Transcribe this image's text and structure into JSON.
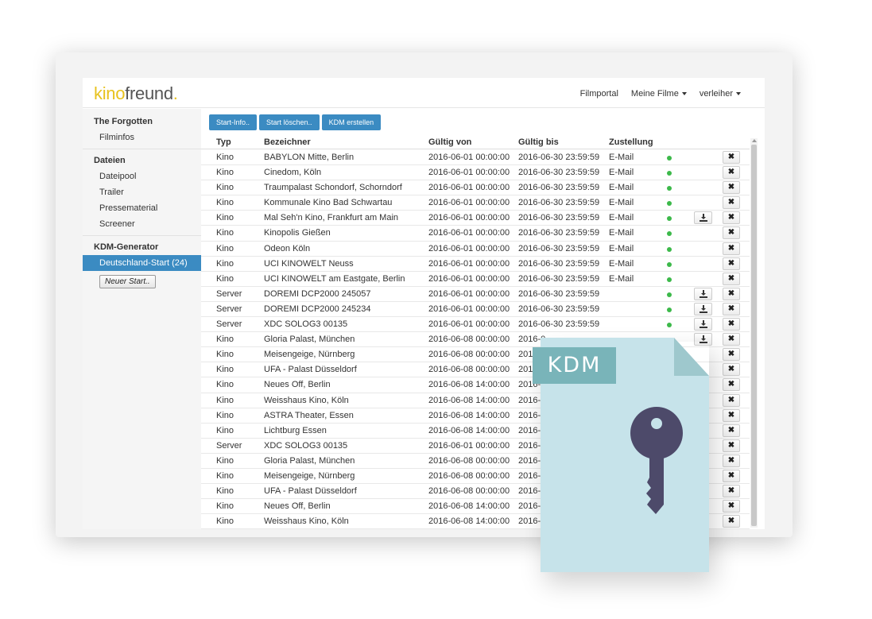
{
  "header": {
    "logo_kino": "kino",
    "logo_freund": "freund",
    "logo_dot": ".",
    "nav": {
      "filmportal": "Filmportal",
      "meine_filme": "Meine Filme",
      "verleiher": "verleiher"
    }
  },
  "sidebar": {
    "group1_title": "The Forgotten",
    "group1_item": "Filminfos",
    "group2_title": "Dateien",
    "group2_items": [
      "Dateipool",
      "Trailer",
      "Pressematerial",
      "Screener"
    ],
    "group3_title": "KDM-Generator",
    "active_item": "Deutschland-Start (24)",
    "new_button": "Neuer Start.."
  },
  "toolbar": {
    "start_info": "Start-Info..",
    "start_loeschen": "Start löschen..",
    "kdm_erstellen": "KDM erstellen"
  },
  "table": {
    "headers": {
      "typ": "Typ",
      "bezeichner": "Bezeichner",
      "gueltig_von": "Gültig von",
      "gueltig_bis": "Gültig bis",
      "zustellung": "Zustellung"
    },
    "rows": [
      {
        "typ": "Kino",
        "bez": "BABYLON Mitte, Berlin",
        "von": "2016-06-01 00:00:00",
        "bis": "2016-06-30 23:59:59",
        "zus": "E-Mail",
        "dot": true,
        "dl": false
      },
      {
        "typ": "Kino",
        "bez": "Cinedom, Köln",
        "von": "2016-06-01 00:00:00",
        "bis": "2016-06-30 23:59:59",
        "zus": "E-Mail",
        "dot": true,
        "dl": false
      },
      {
        "typ": "Kino",
        "bez": "Traumpalast Schondorf, Schorndorf",
        "von": "2016-06-01 00:00:00",
        "bis": "2016-06-30 23:59:59",
        "zus": "E-Mail",
        "dot": true,
        "dl": false
      },
      {
        "typ": "Kino",
        "bez": "Kommunale Kino Bad Schwartau",
        "von": "2016-06-01 00:00:00",
        "bis": "2016-06-30 23:59:59",
        "zus": "E-Mail",
        "dot": true,
        "dl": false
      },
      {
        "typ": "Kino",
        "bez": "Mal Seh'n Kino, Frankfurt am Main",
        "von": "2016-06-01 00:00:00",
        "bis": "2016-06-30 23:59:59",
        "zus": "E-Mail",
        "dot": true,
        "dl": true
      },
      {
        "typ": "Kino",
        "bez": "Kinopolis Gießen",
        "von": "2016-06-01 00:00:00",
        "bis": "2016-06-30 23:59:59",
        "zus": "E-Mail",
        "dot": true,
        "dl": false
      },
      {
        "typ": "Kino",
        "bez": "Odeon Köln",
        "von": "2016-06-01 00:00:00",
        "bis": "2016-06-30 23:59:59",
        "zus": "E-Mail",
        "dot": true,
        "dl": false
      },
      {
        "typ": "Kino",
        "bez": "UCI KINOWELT Neuss",
        "von": "2016-06-01 00:00:00",
        "bis": "2016-06-30 23:59:59",
        "zus": "E-Mail",
        "dot": true,
        "dl": false
      },
      {
        "typ": "Kino",
        "bez": "UCI KINOWELT am Eastgate, Berlin",
        "von": "2016-06-01 00:00:00",
        "bis": "2016-06-30 23:59:59",
        "zus": "E-Mail",
        "dot": true,
        "dl": false
      },
      {
        "typ": "Server",
        "bez": "DOREMI DCP2000 245057",
        "von": "2016-06-01 00:00:00",
        "bis": "2016-06-30 23:59:59",
        "zus": "",
        "dot": true,
        "dl": true
      },
      {
        "typ": "Server",
        "bez": "DOREMI DCP2000 245234",
        "von": "2016-06-01 00:00:00",
        "bis": "2016-06-30 23:59:59",
        "zus": "",
        "dot": true,
        "dl": true
      },
      {
        "typ": "Server",
        "bez": "XDC SOLOG3 00135",
        "von": "2016-06-01 00:00:00",
        "bis": "2016-06-30 23:59:59",
        "zus": "",
        "dot": true,
        "dl": true
      },
      {
        "typ": "Kino",
        "bez": "Gloria Palast, München",
        "von": "2016-06-08 00:00:00",
        "bis": "2016-0",
        "zus": "",
        "dot": false,
        "dl": true
      },
      {
        "typ": "Kino",
        "bez": "Meisengeige, Nürnberg",
        "von": "2016-06-08 00:00:00",
        "bis": "201",
        "zus": "",
        "dot": false,
        "dl": false
      },
      {
        "typ": "Kino",
        "bez": "UFA - Palast Düsseldorf",
        "von": "2016-06-08 00:00:00",
        "bis": "201",
        "zus": "",
        "dot": false,
        "dl": false
      },
      {
        "typ": "Kino",
        "bez": "Neues Off, Berlin",
        "von": "2016-06-08 14:00:00",
        "bis": "2016-0",
        "zus": "",
        "dot": false,
        "dl": false
      },
      {
        "typ": "Kino",
        "bez": "Weisshaus Kino, Köln",
        "von": "2016-06-08 14:00:00",
        "bis": "2016-0",
        "zus": "",
        "dot": false,
        "dl": false
      },
      {
        "typ": "Kino",
        "bez": "ASTRA Theater, Essen",
        "von": "2016-06-08 14:00:00",
        "bis": "2016-0",
        "zus": "",
        "dot": false,
        "dl": false
      },
      {
        "typ": "Kino",
        "bez": "Lichtburg Essen",
        "von": "2016-06-08 14:00:00",
        "bis": "2016-0",
        "zus": "",
        "dot": false,
        "dl": false
      },
      {
        "typ": "Server",
        "bez": "XDC SOLOG3 00135",
        "von": "2016-06-01 00:00:00",
        "bis": "2016-0",
        "zus": "",
        "dot": false,
        "dl": false
      },
      {
        "typ": "Kino",
        "bez": "Gloria Palast, München",
        "von": "2016-06-08 00:00:00",
        "bis": "2016-0",
        "zus": "",
        "dot": false,
        "dl": false
      },
      {
        "typ": "Kino",
        "bez": "Meisengeige, Nürnberg",
        "von": "2016-06-08 00:00:00",
        "bis": "2016-0",
        "zus": "",
        "dot": false,
        "dl": false
      },
      {
        "typ": "Kino",
        "bez": "UFA - Palast Düsseldorf",
        "von": "2016-06-08 00:00:00",
        "bis": "2016-0",
        "zus": "",
        "dot": false,
        "dl": false
      },
      {
        "typ": "Kino",
        "bez": "Neues Off, Berlin",
        "von": "2016-06-08 14:00:00",
        "bis": "2016-0",
        "zus": "",
        "dot": false,
        "dl": false
      },
      {
        "typ": "Kino",
        "bez": "Weisshaus Kino, Köln",
        "von": "2016-06-08 14:00:00",
        "bis": "2016-0",
        "zus": "",
        "dot": false,
        "dl": false
      }
    ],
    "delete_glyph": "✖"
  },
  "overlay": {
    "kdm_label": "KDM",
    "icon": "key-icon"
  },
  "colors": {
    "accent": "#3b8bc2",
    "logo_yellow": "#e8c21e",
    "status_green": "#3cb94a",
    "doc_body": "#c6e3ea",
    "doc_fold": "#9ec8cd",
    "kdm_label_bg": "#79b4b9",
    "key": "#4d4a6a"
  }
}
